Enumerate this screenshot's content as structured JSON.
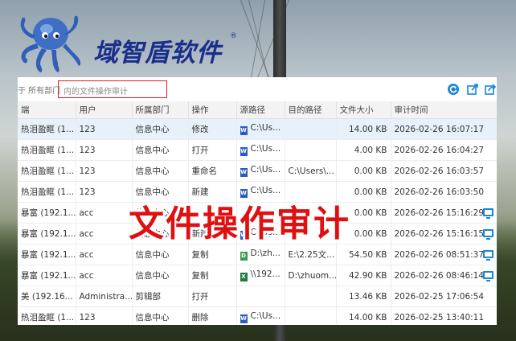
{
  "brand": {
    "name": "域智盾软件",
    "reg_mark": "®"
  },
  "toolbar": {
    "scope_label": "于 所有部门",
    "search_placeholder": "内的文件操作审计",
    "refresh_icon": "refresh-icon",
    "export_icon": "export-icon",
    "share_icon": "share-icon"
  },
  "table": {
    "columns": [
      "端",
      "用户",
      "所属部门",
      "操作",
      "源路径",
      "目的路径",
      "文件大小",
      "审计时间"
    ],
    "rows": [
      {
        "endpoint": "热泪盈眶 (1...",
        "user": "123",
        "dept": "信息中心",
        "op": "修改",
        "file_icon": "word",
        "src": "C:\\Us...",
        "dst": "",
        "size": "14.00 KB",
        "time": "2026-02-26 16:07:17",
        "selected": true,
        "monitor": false
      },
      {
        "endpoint": "热泪盈眶 (1...",
        "user": "123",
        "dept": "信息中心",
        "op": "打开",
        "file_icon": "word",
        "src": "C:\\Us...",
        "dst": "",
        "size": "4.00 KB",
        "time": "2026-02-26 16:04:27",
        "selected": false,
        "monitor": false
      },
      {
        "endpoint": "热泪盈眶 (1...",
        "user": "123",
        "dept": "信息中心",
        "op": "重命名",
        "file_icon": "word",
        "src": "C:\\Us...",
        "dst": "C:\\Users\\...",
        "size": "0.00 KB",
        "time": "2026-02-26 16:03:57",
        "selected": false,
        "monitor": false
      },
      {
        "endpoint": "热泪盈眶 (1...",
        "user": "123",
        "dept": "信息中心",
        "op": "新建",
        "file_icon": "word",
        "src": "C:\\Us...",
        "dst": "",
        "size": "0.00 KB",
        "time": "2026-02-26 16:03:50",
        "selected": false,
        "monitor": false
      },
      {
        "endpoint": "暴富 (192.1...",
        "user": "acc",
        "dept": "信息中心",
        "op": "",
        "file_icon": "",
        "src": "",
        "dst": "",
        "size": "0.00 KB",
        "time": "2026-02-26 15:16:29",
        "selected": false,
        "monitor": true
      },
      {
        "endpoint": "暴富 (192.1...",
        "user": "acc",
        "dept": "信息中心",
        "op": "新建",
        "file_icon": "word",
        "src": "C:\\Us...",
        "dst": "",
        "size": "0.00 KB",
        "time": "2026-02-26 15:16:15",
        "selected": false,
        "monitor": true
      },
      {
        "endpoint": "暴富 (192.1...",
        "user": "acc",
        "dept": "信息中心",
        "op": "复制",
        "file_icon": "doc",
        "src": "D:\\zh...",
        "dst": "E:\\2.25文...",
        "size": "54.50 KB",
        "time": "2026-02-26 08:51:37",
        "selected": false,
        "monitor": true
      },
      {
        "endpoint": "暴富 (192.1...",
        "user": "acc",
        "dept": "信息中心",
        "op": "复制",
        "file_icon": "xls",
        "src": "\\\\192...",
        "dst": "D:\\zhuom...",
        "size": "42.90 KB",
        "time": "2026-02-26 08:46:14",
        "selected": false,
        "monitor": true
      },
      {
        "endpoint": "美 (192.16...",
        "user": "Administra...",
        "dept": "剪辑部",
        "op": "打开",
        "file_icon": "",
        "src": "",
        "dst": "",
        "size": "13.46 KB",
        "time": "2026-02-25 17:06:54",
        "selected": false,
        "monitor": false
      },
      {
        "endpoint": "热泪盈眶 (1...",
        "user": "123",
        "dept": "信息中心",
        "op": "删除",
        "file_icon": "word",
        "src": "C:\\Us...",
        "dst": "",
        "size": "14.00 KB",
        "time": "2026-02-25 13:40:11",
        "selected": false,
        "monitor": false
      }
    ]
  },
  "overlay_caption": "文件操作审计",
  "colors": {
    "accent": "#1a86d8",
    "brand": "#1a2f8c",
    "caption": "#e01010",
    "highlight_box": "#e02020"
  }
}
